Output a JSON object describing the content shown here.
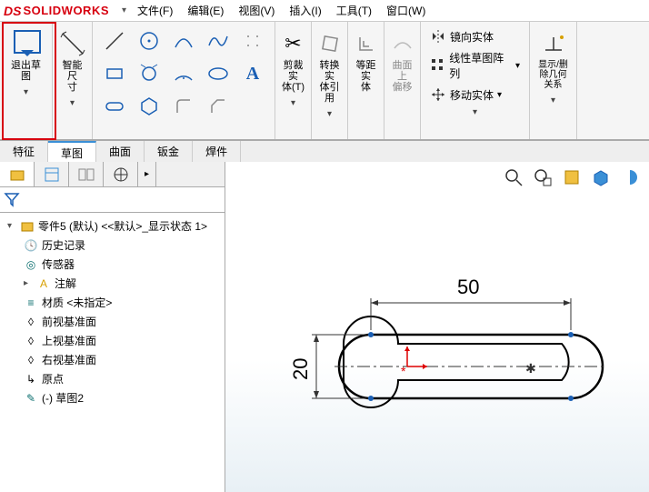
{
  "app": {
    "logo_prefix": "DS",
    "logo_text": "SOLIDWORKS"
  },
  "menu": {
    "items": [
      "文件(F)",
      "编辑(E)",
      "视图(V)",
      "插入(I)",
      "工具(T)",
      "窗口(W)"
    ]
  },
  "ribbon": {
    "exit_sketch": "退出草\n图",
    "smart_dim": "智能尺\n寸",
    "trim": "剪裁实\n体(T)",
    "convert": "转换实\n体引用",
    "offset": "等距实\n体",
    "surface_offset_label": "曲面上\n偏移",
    "mirror": "镜向实体",
    "linear_pattern": "线性草图阵列",
    "move": "移动实体",
    "display_delete": "显示/删\n除几何\n关系"
  },
  "tabs": [
    "特征",
    "草图",
    "曲面",
    "钣金",
    "焊件"
  ],
  "tree": {
    "part_name": "零件5 (默认) <<默认>_显示状态 1>",
    "history": "历史记录",
    "sensors": "传感器",
    "annotations": "注解",
    "material": "材质 <未指定>",
    "front_plane": "前视基准面",
    "top_plane": "上视基准面",
    "right_plane": "右视基准面",
    "origin": "原点",
    "sketch2": "(-) 草图2"
  },
  "sketch": {
    "dim_width": "50",
    "dim_height": "20"
  }
}
